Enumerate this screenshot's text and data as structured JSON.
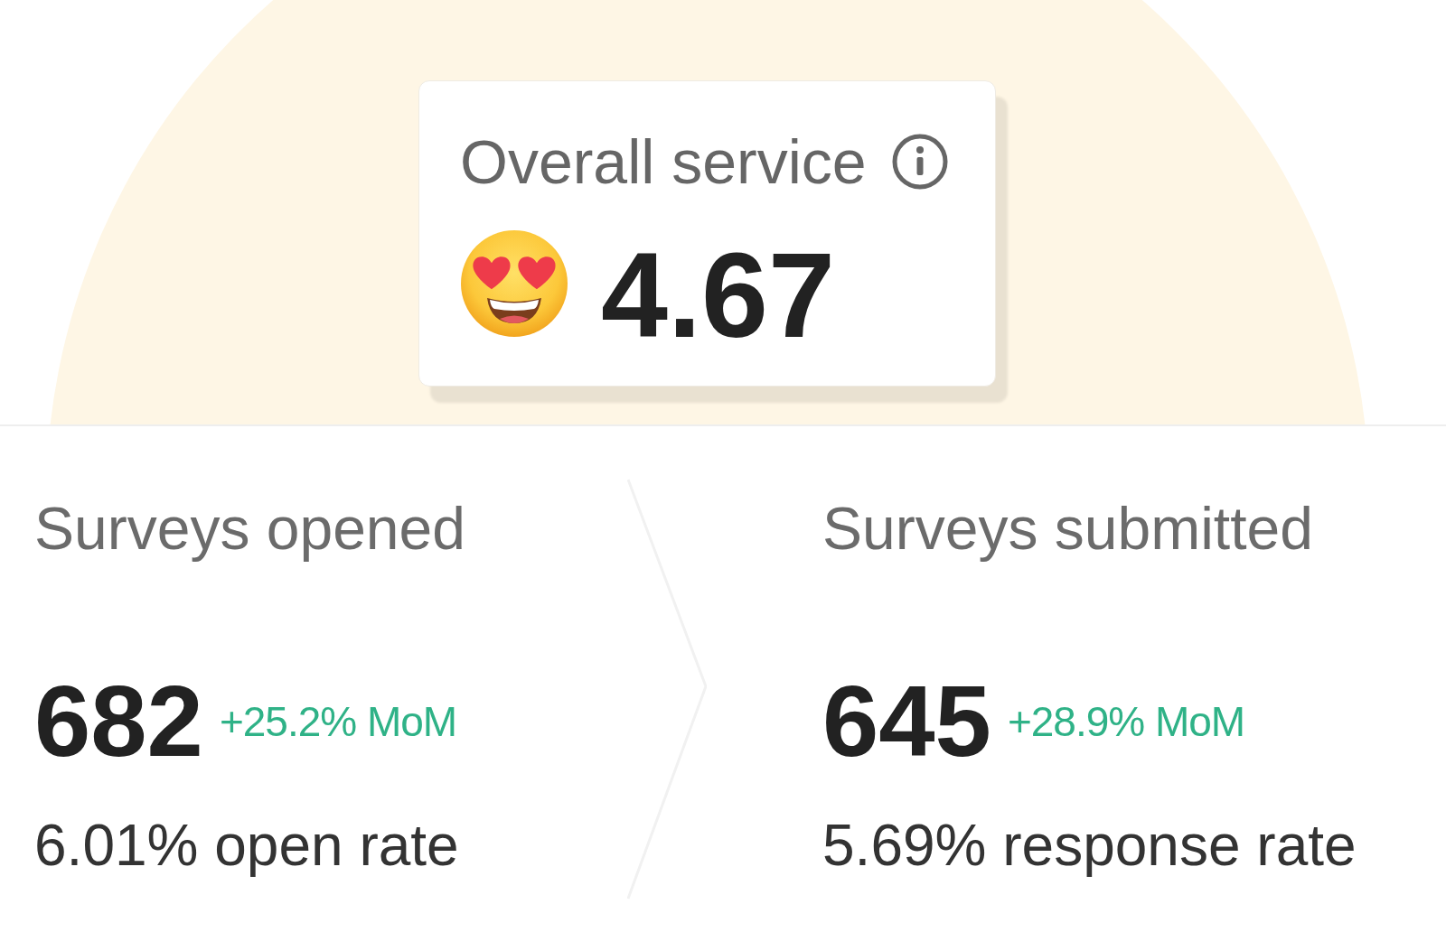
{
  "overall_card": {
    "label": "Overall service",
    "score": "4.67"
  },
  "stats": [
    {
      "label": "Surveys opened",
      "value": "682",
      "change": "+25.2% MoM",
      "rate": "6.01% open rate"
    },
    {
      "label": "Surveys submitted",
      "value": "645",
      "change": "+28.9% MoM",
      "rate": "5.69% response rate"
    }
  ]
}
